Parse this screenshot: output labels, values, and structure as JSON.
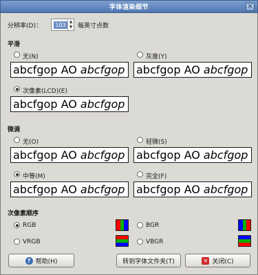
{
  "window": {
    "title": "字体渲染细节"
  },
  "resolution": {
    "label": "分辨率(D)：",
    "value": "103",
    "unit": "每英寸点数"
  },
  "smoothing": {
    "heading": "平滑",
    "options": [
      {
        "label": "无(N)",
        "selected": false
      },
      {
        "label": "灰度(Y)",
        "selected": false
      },
      {
        "label": "次像素(LCD)(E)",
        "selected": true
      }
    ]
  },
  "hinting": {
    "heading": "微调",
    "options": [
      {
        "label": "无(O)",
        "selected": false
      },
      {
        "label": "轻微(S)",
        "selected": false
      },
      {
        "label": "中等(M)",
        "selected": true
      },
      {
        "label": "完全(F)",
        "selected": false
      }
    ]
  },
  "preview": {
    "plain": "abcfgop AO ",
    "italic": "abcfgop"
  },
  "subpixel": {
    "heading": "次像素顺序",
    "options": [
      {
        "label": "RGB",
        "selected": true,
        "colors": [
          "#ff0000",
          "#00b000",
          "#0000ff"
        ]
      },
      {
        "label": "BGR",
        "selected": false,
        "colors": [
          "#0000ff",
          "#00b000",
          "#ff0000"
        ]
      },
      {
        "label": "VRGB",
        "selected": false,
        "colors": [
          "#ff0000",
          "#00b000",
          "#0000ff"
        ]
      },
      {
        "label": "VBGR",
        "selected": false,
        "colors": [
          "#0000ff",
          "#00b000",
          "#ff0000"
        ]
      }
    ]
  },
  "buttons": {
    "help": "帮助(H)",
    "goto": "转到字体文件夹(T)",
    "close": "关闭(C)"
  },
  "icons": {
    "help": "?",
    "close": "✕",
    "window_close": "✕",
    "spin": "▲▼"
  }
}
